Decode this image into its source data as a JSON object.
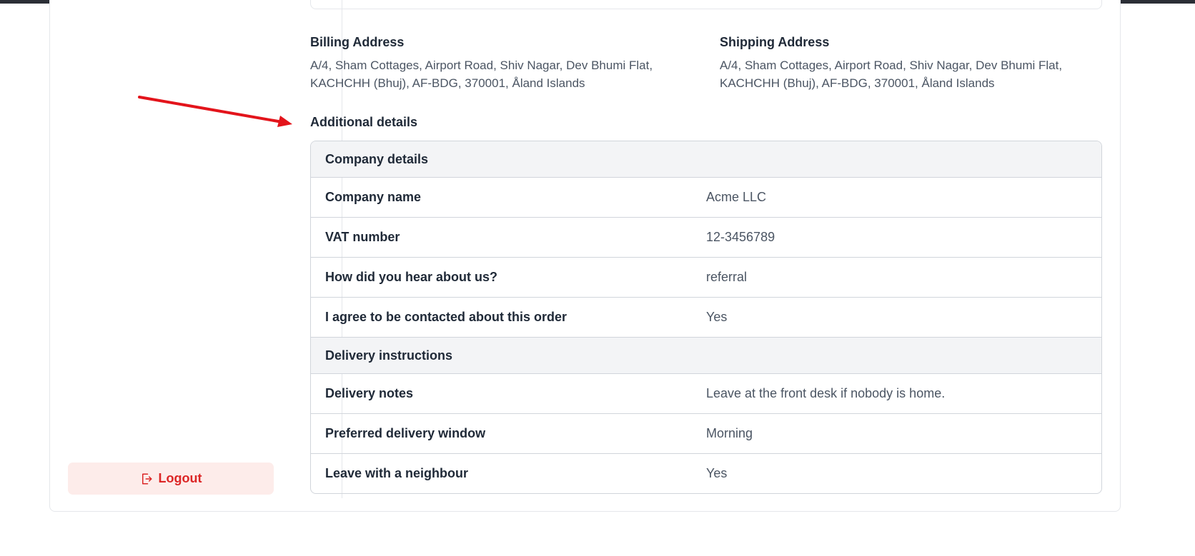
{
  "billing": {
    "title": "Billing Address",
    "line1": "A/4, Sham Cottages, Airport Road, Shiv Nagar, Dev Bhumi Flat,",
    "line2": "KACHCHH (Bhuj), AF-BDG, 370001, Åland Islands"
  },
  "shipping": {
    "title": "Shipping Address",
    "line1": "A/4, Sham Cottages, Airport Road, Shiv Nagar, Dev Bhumi Flat,",
    "line2": "KACHCHH (Bhuj), AF-BDG, 370001, Åland Islands"
  },
  "additional": {
    "heading": "Additional details",
    "groups": [
      {
        "title": "Company details",
        "rows": [
          {
            "label": "Company name",
            "value": "Acme LLC"
          },
          {
            "label": "VAT number",
            "value": "12-3456789"
          },
          {
            "label": "How did you hear about us?",
            "value": "referral"
          },
          {
            "label": "I agree to be contacted about this order",
            "value": "Yes"
          }
        ]
      },
      {
        "title": "Delivery instructions",
        "rows": [
          {
            "label": "Delivery notes",
            "value": "Leave at the front desk if nobody is home."
          },
          {
            "label": "Preferred delivery window",
            "value": "Morning"
          },
          {
            "label": "Leave with a neighbour",
            "value": "Yes"
          }
        ]
      }
    ]
  },
  "sidebar": {
    "logout_label": "Logout",
    "logout_icon": "logout-icon"
  },
  "annotation": {
    "arrow_color": "#e3141b"
  },
  "colors": {
    "logout_bg": "#fdecea",
    "logout_text": "#dc2626",
    "group_header_bg": "#f3f4f6"
  }
}
